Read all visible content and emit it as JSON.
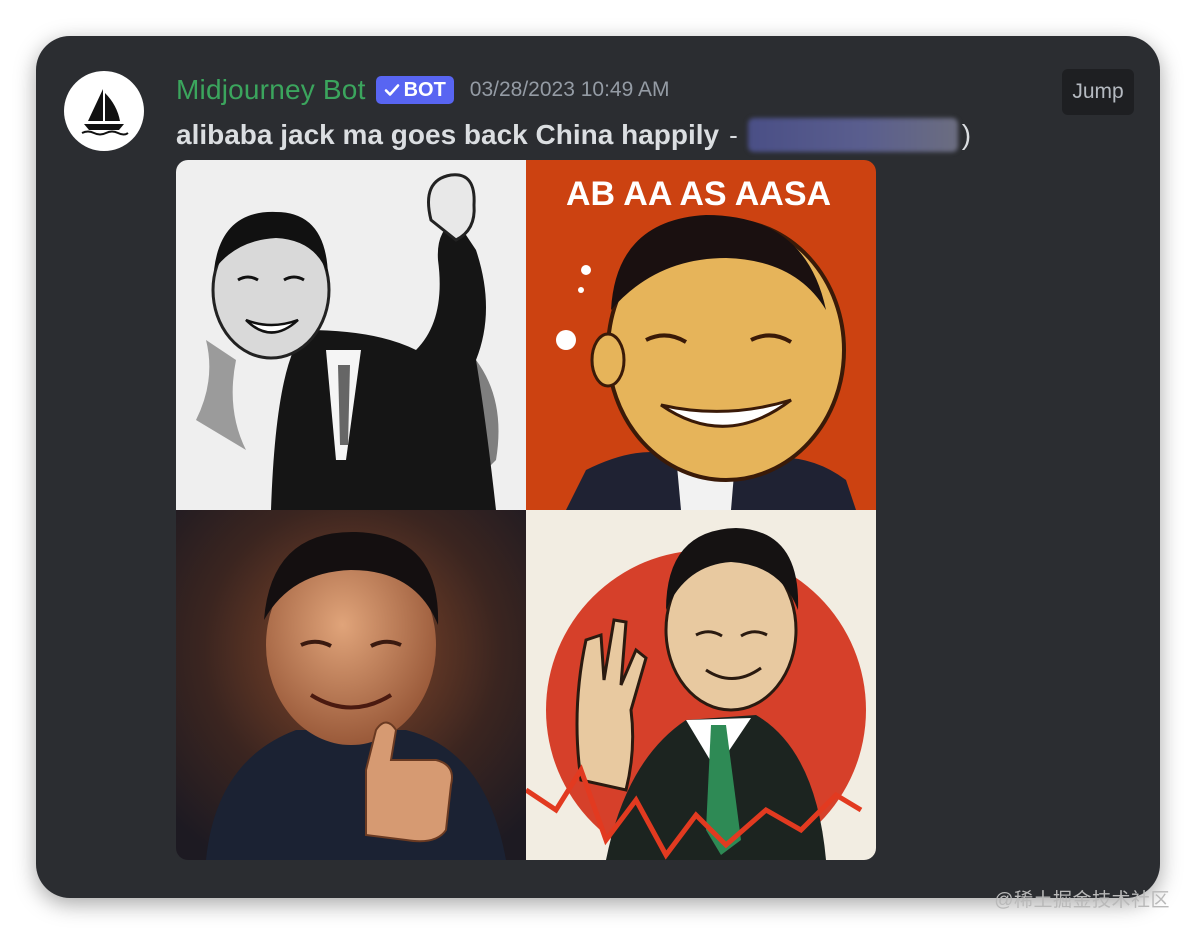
{
  "message": {
    "author": "Midjourney Bot",
    "badge": "BOT",
    "timestamp": "03/28/2023 10:49 AM",
    "prompt": "alibaba jack ma goes back China happily",
    "separator": "-",
    "closing": ")",
    "jump_label": "Jump"
  },
  "images": {
    "top_right_caption": "AB AA AS AASA"
  },
  "colors": {
    "background": "#2b2d31",
    "username": "#3ba55d",
    "badge": "#5865f2",
    "timestamp": "#949ba4",
    "text": "#dbdee1"
  },
  "watermark": "@稀土掘金技术社区"
}
